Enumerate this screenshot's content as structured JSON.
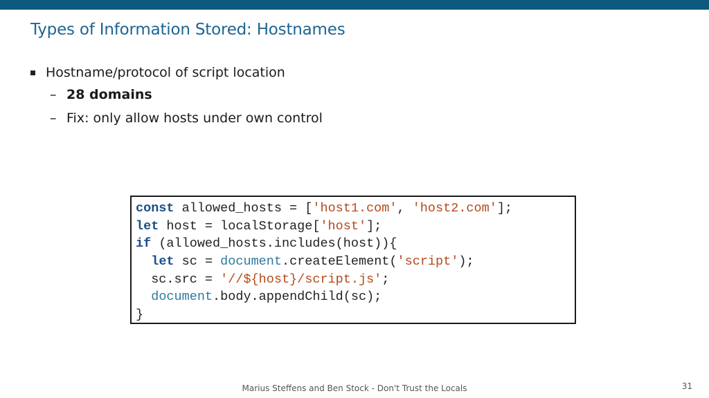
{
  "slide": {
    "title": "Types of Information Stored: Hostnames",
    "bullet": "Hostname/protocol of script location",
    "sub_bullets": [
      "28 domains",
      "Fix: only allow hosts under own control"
    ],
    "dash": "–",
    "footer": "Marius Steffens and Ben Stock - Don't Trust the Locals",
    "page_number": "31",
    "colors": {
      "accent_bar": "#0e5a7f",
      "title": "#1e6591",
      "keyword": "#1a4f86",
      "string": "#b5491b",
      "builtin": "#317a9c"
    }
  },
  "code": {
    "l1": [
      "const",
      " allowed_hosts = [",
      "'host1.com'",
      ", ",
      "'host2.com'",
      "];"
    ],
    "l2": [
      "let",
      " host = localStorage[",
      "'host'",
      "];"
    ],
    "l3": [
      "if",
      " (allowed_hosts.includes(host)){"
    ],
    "l4": [
      "  ",
      "let",
      " sc = ",
      "document",
      ".createElement(",
      "'script'",
      ");"
    ],
    "l5": [
      "  sc.src = ",
      "'//${host}/script.js'",
      ";"
    ],
    "l6": [
      "  ",
      "document",
      ".body.appendChild(sc);"
    ],
    "l7": [
      "}"
    ]
  }
}
